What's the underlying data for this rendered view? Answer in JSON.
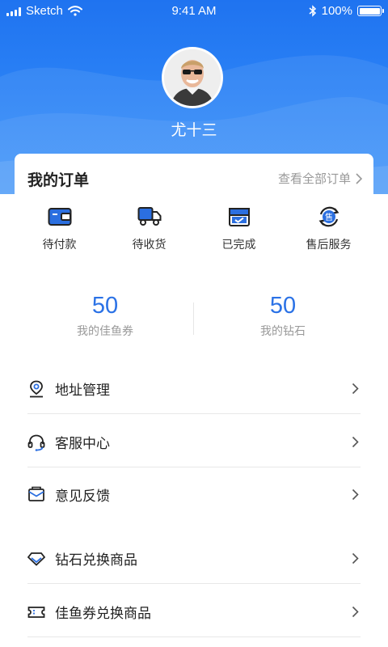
{
  "status_bar": {
    "carrier": "Sketch",
    "time": "9:41 AM",
    "battery": "100%"
  },
  "profile": {
    "username": "尤十三"
  },
  "orders": {
    "title": "我的订单",
    "view_all": "查看全部订单",
    "items": [
      {
        "label": "待付款",
        "icon": "wallet-icon"
      },
      {
        "label": "待收货",
        "icon": "truck-icon"
      },
      {
        "label": "已完成",
        "icon": "box-check-icon"
      },
      {
        "label": "售后服务",
        "icon": "after-sale-icon"
      }
    ]
  },
  "stats": [
    {
      "value": "50",
      "label": "我的佳鱼券"
    },
    {
      "value": "50",
      "label": "我的钻石"
    }
  ],
  "menu": [
    {
      "label": "地址管理",
      "icon": "location-icon"
    },
    {
      "label": "客服中心",
      "icon": "headset-icon"
    },
    {
      "label": "意见反馈",
      "icon": "mail-icon"
    },
    {
      "label": "钻石兑换商品",
      "icon": "diamond-icon"
    },
    {
      "label": "佳鱼券兑换商品",
      "icon": "ticket-icon"
    }
  ],
  "colors": {
    "header_blue": "#1f73f0",
    "accent_blue": "#2b72e6",
    "secondary_text": "#999999"
  }
}
